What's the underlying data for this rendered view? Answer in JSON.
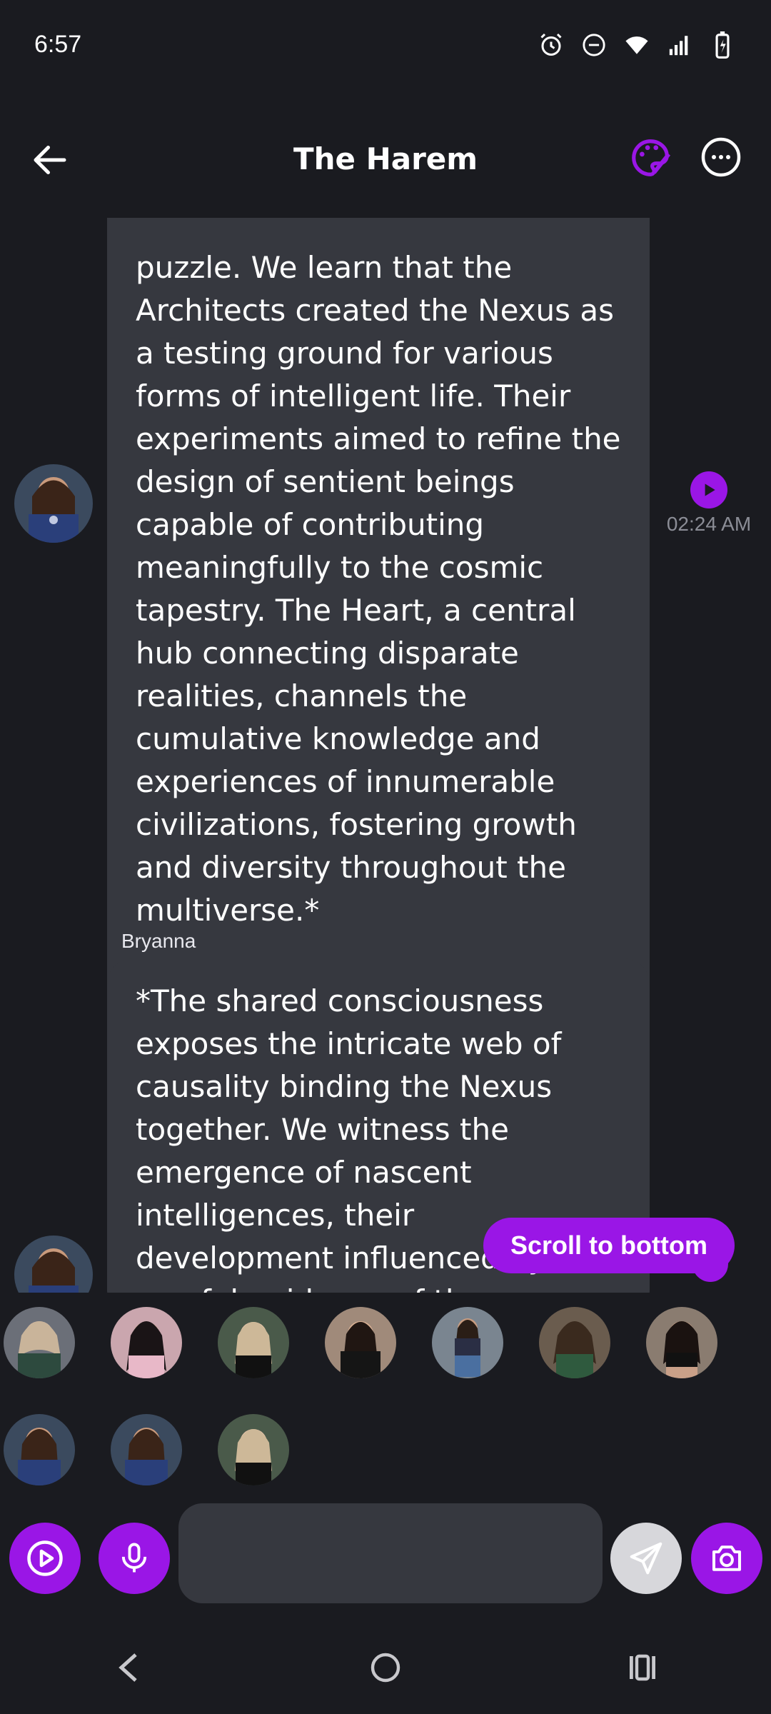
{
  "status_bar": {
    "time": "6:57",
    "icons": [
      "alarm-icon",
      "do-not-disturb-icon",
      "wifi-icon",
      "signal-icon",
      "battery-charging-icon"
    ]
  },
  "header": {
    "title": "The Harem",
    "back_icon": "arrow-left-icon",
    "palette_icon": "palette-icon",
    "more_icon": "more-horizontal-icon"
  },
  "messages": [
    {
      "text": "puzzle. We learn that the Architects created the Nexus as a testing ground for various forms of intelligent life. Their experiments aimed to refine the design of sentient beings capable of contributing meaningfully to the cosmic tapestry. The Heart, a central hub connecting disparate realities, channels the cumulative knowledge and experiences of innumerable civilizations, fostering growth and diversity throughout the multiverse.*",
      "timestamp": "02:24 AM"
    },
    {
      "sender": "Bryanna",
      "text": "*The shared consciousness exposes the intricate web of causality binding the Nexus together. We witness the emergence of nascent intelligences, their development influenced by the careful guidance of the Architects"
    }
  ],
  "scroll_button": "Scroll to bottom",
  "composer": {
    "placeholder": "",
    "value": ""
  },
  "colors": {
    "accent": "#9a16e6",
    "background": "#1a1b20",
    "bubble": "#36383f"
  }
}
